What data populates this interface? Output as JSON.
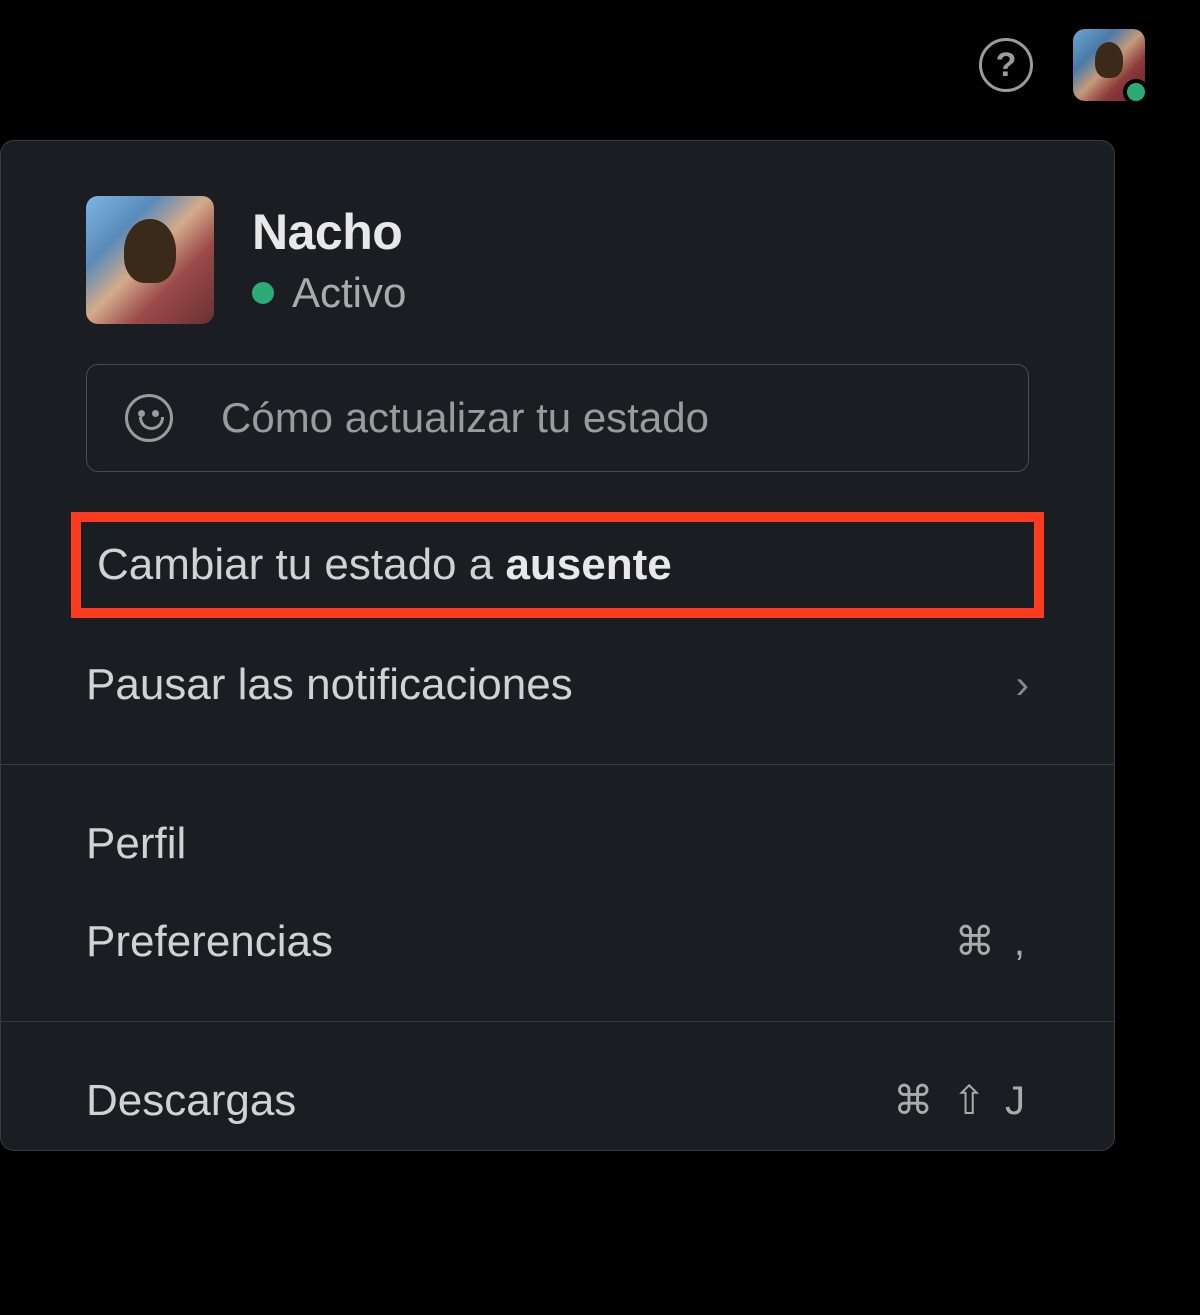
{
  "topbar": {
    "help_tooltip": "Help"
  },
  "user": {
    "name": "Nacho",
    "status_text": "Activo",
    "status_color": "#2bac76"
  },
  "status_input": {
    "placeholder": "Cómo actualizar tu estado"
  },
  "menu": {
    "change_status_prefix": "Cambiar tu estado a ",
    "change_status_bold": "ausente",
    "pause_notifications": "Pausar las notificaciones",
    "profile": "Perfil",
    "preferences": "Preferencias",
    "preferences_shortcut": "⌘ ,",
    "downloads": "Descargas",
    "downloads_shortcut": "⌘ ⇧ J"
  }
}
